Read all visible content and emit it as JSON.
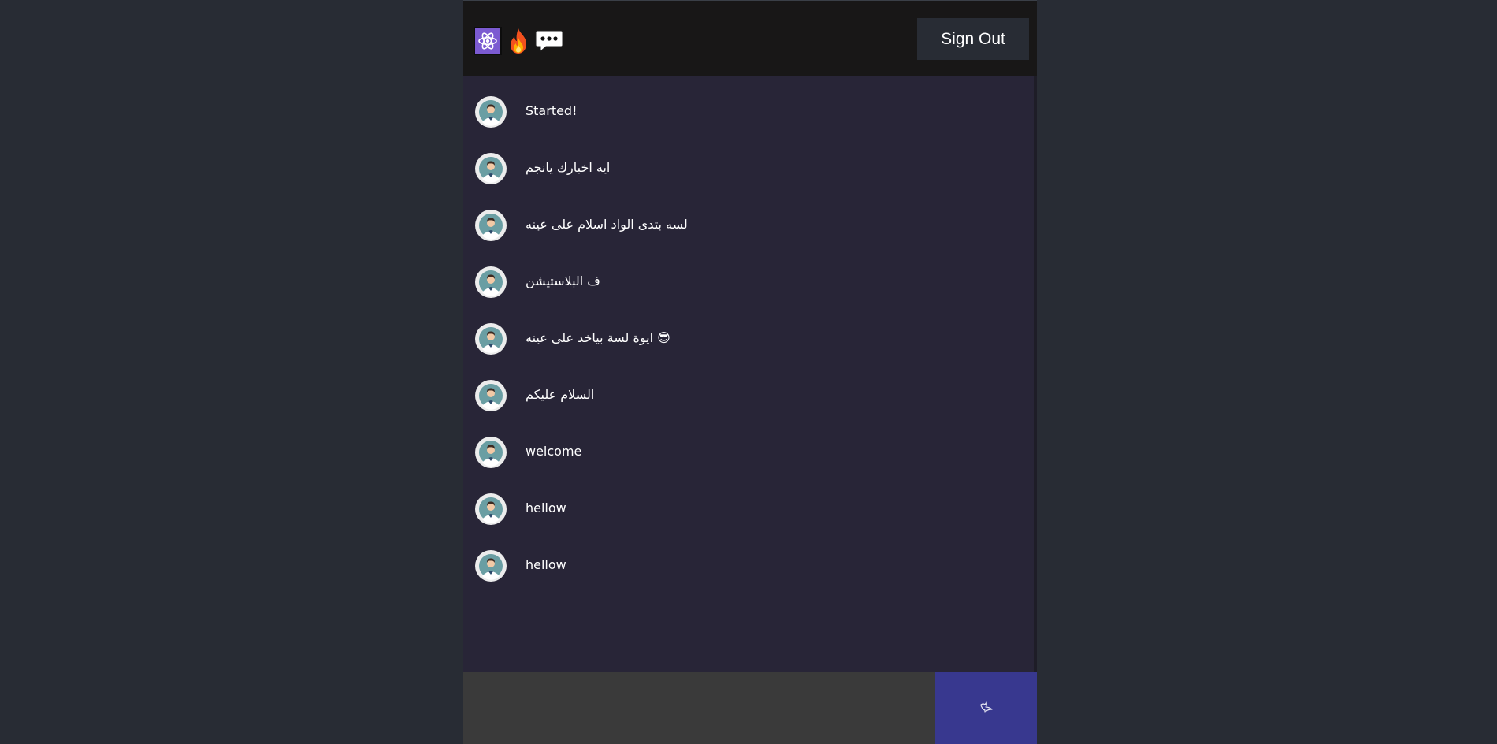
{
  "header": {
    "logo_icons": [
      "atom-icon",
      "fire-icon",
      "speech-bubble-icon"
    ],
    "signout_label": "Sign Out"
  },
  "messages": [
    {
      "text": "Started!",
      "avatar": "user-avatar-icon"
    },
    {
      "text": "ايه اخبارك يانجم",
      "avatar": "user-avatar-icon"
    },
    {
      "text": "لسه بتدى الواد اسلام على عينه",
      "avatar": "user-avatar-icon"
    },
    {
      "text": "ف البلاستيشن",
      "avatar": "user-avatar-icon"
    },
    {
      "text": "ايوة لسة بياخد على عينه 😎",
      "avatar": "user-avatar-icon"
    },
    {
      "text": "السلام عليكم",
      "avatar": "user-avatar-icon"
    },
    {
      "text": "welcome",
      "avatar": "user-avatar-icon"
    },
    {
      "text": "hellow",
      "avatar": "user-avatar-icon"
    },
    {
      "text": "hellow",
      "avatar": "user-avatar-icon"
    }
  ],
  "composer": {
    "input_value": "",
    "send_icon": "dove-icon"
  },
  "colors": {
    "page_bg": "#282c34",
    "header_bg": "#181717",
    "chat_bg": "#282537",
    "composer_bg": "#3a3a3a",
    "send_bg": "#38388f",
    "react_logo_bg": "#7b5ad1"
  }
}
